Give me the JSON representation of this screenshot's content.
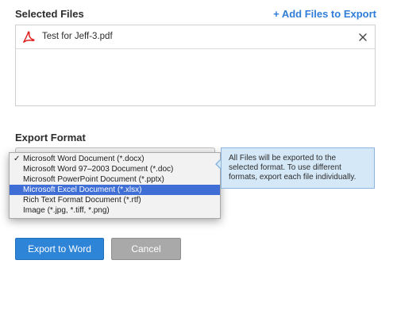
{
  "selected_files": {
    "heading": "Selected Files",
    "add_link": "+ Add Files to Export",
    "files": [
      {
        "name": "Test for Jeff-3.pdf",
        "icon": "pdf-icon"
      }
    ]
  },
  "export_format": {
    "heading": "Export Format",
    "options": [
      {
        "label": "Microsoft Word Document (*.docx)",
        "checked": true
      },
      {
        "label": "Microsoft Word 97–2003 Document (*.doc)"
      },
      {
        "label": "Microsoft PowerPoint Document (*.pptx)"
      },
      {
        "label": "Microsoft Excel Document (*.xlsx)",
        "highlighted": true
      },
      {
        "label": "Rich Text Format Document (*.rtf)"
      },
      {
        "label": "Image (*.jpg, *.tiff, *.png)"
      }
    ],
    "check_glyph": "✓"
  },
  "info": {
    "text": "All Files will be exported to the selected format. To use different formats, export each file individually."
  },
  "buttons": {
    "export_label": "Export to Word",
    "cancel_label": "Cancel"
  },
  "colors": {
    "accent": "#2e84d6",
    "link": "#2f7dd8",
    "highlight": "#3f6fd6",
    "info_bg": "#d5e8f8",
    "pdf_red": "#e02020"
  }
}
